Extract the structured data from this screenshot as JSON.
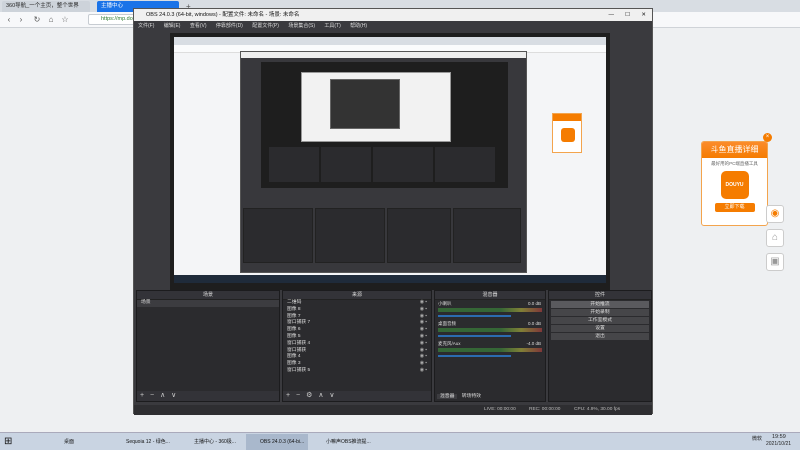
{
  "browser": {
    "tabs": [
      {
        "label": "360导航_一个主页，整个世界"
      },
      {
        "label": "主播中心"
      }
    ],
    "address": "https://mp.do",
    "back": "‹",
    "forward": "›",
    "reload": "↻",
    "home": "⌂",
    "star": "☆"
  },
  "obs": {
    "title": "OBS 24.0.3 (64-bit, windows) - 配置文件: 未命名 - 场景: 未命名",
    "menu": [
      "文件(F)",
      "编辑(E)",
      "查看(V)",
      "停靠部件(D)",
      "配置文件(P)",
      "场景集合(S)",
      "工具(T)",
      "帮助(H)"
    ],
    "window_controls": [
      "—",
      "☐",
      "✕"
    ],
    "scenes": {
      "title": "场景",
      "items": [
        "场景"
      ]
    },
    "sources": {
      "title": "来源",
      "items": [
        "二维码",
        "图像 8",
        "图像 7",
        "窗口捕获 7",
        "图像 6",
        "图像 5",
        "窗口捕获 4",
        "窗口捕获",
        "图像 4",
        "图像 3",
        "窗口捕获 5"
      ]
    },
    "mixer": {
      "title": "混音器",
      "channels": [
        {
          "name": "小喇叭",
          "db": "0.0 dB"
        },
        {
          "name": "桌面音频",
          "db": "0.0 dB"
        },
        {
          "name": "麦克风/Aux",
          "db": "-4.0 dB"
        }
      ],
      "tabs": [
        "混音器",
        "转场特效"
      ]
    },
    "controls": {
      "title": "控件",
      "buttons": [
        "开始推流",
        "开始录制",
        "工作室模式",
        "设置",
        "退出"
      ]
    },
    "footer_symbols": {
      "add": "+",
      "remove": "−",
      "up": "∧",
      "down": "∨",
      "settings": "⚙"
    },
    "status": {
      "live": "LIVE: 00:00:00",
      "rec": "REC: 00:00:00",
      "cpu": "CPU: 4.9%, 30.00 fps"
    }
  },
  "taskbar": {
    "items": [
      "桌面",
      "Sequoia 12 - 绿色...",
      "主播中心 - 360极...",
      "OBS 24.0.3 (64-bi...",
      "小嘛声OBS推流提..."
    ],
    "time": "19:59",
    "date": "2021/10/21",
    "ime": "微软"
  },
  "promo": {
    "title": "斗鱼直播详细",
    "subtitle": "最好用的PC端直播工具",
    "logo": "DOUYU",
    "button": "立即下载"
  },
  "colors": {
    "accent": "#f57c00",
    "obs_bg": "#3a3a3e",
    "panel_bg": "#2b2b2e"
  }
}
